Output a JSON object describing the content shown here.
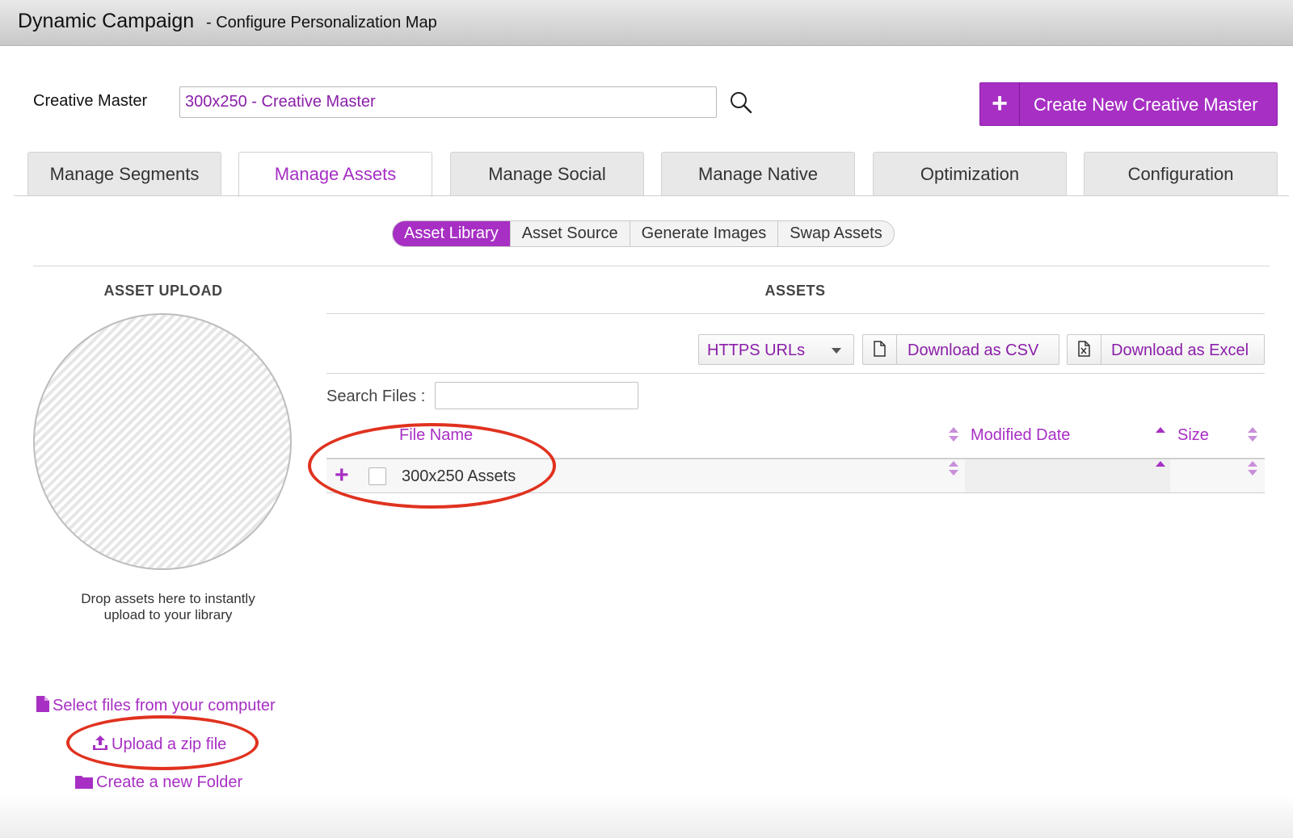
{
  "header": {
    "title": "Dynamic Campaign",
    "subtitle": "- Configure Personalization Map"
  },
  "creative_master": {
    "label": "Creative Master",
    "value": "300x250 - Creative Master",
    "search_icon": "magnifier-icon",
    "create_button": {
      "icon": "plus-icon",
      "label": "Create New Creative Master"
    }
  },
  "tabs": [
    {
      "label": "Manage Segments",
      "active": false
    },
    {
      "label": "Manage Assets",
      "active": true
    },
    {
      "label": "Manage Social",
      "active": false
    },
    {
      "label": "Manage Native",
      "active": false
    },
    {
      "label": "Optimization",
      "active": false
    },
    {
      "label": "Configuration",
      "active": false
    }
  ],
  "subtabs": [
    {
      "label": "Asset Library",
      "active": true
    },
    {
      "label": "Asset Source",
      "active": false
    },
    {
      "label": "Generate Images",
      "active": false
    },
    {
      "label": "Swap Assets",
      "active": false
    }
  ],
  "upload": {
    "title": "ASSET UPLOAD",
    "drop_text_line1": "Drop assets here to instantly",
    "drop_text_line2": "upload to your library",
    "select_files": "Select files from your computer",
    "upload_zip": "Upload a zip file",
    "new_folder": "Create a new Folder"
  },
  "assets": {
    "title": "ASSETS",
    "url_select": "HTTPS URLs",
    "download_csv": "Download as CSV",
    "download_excel": "Download as Excel",
    "search_label": "Search Files :",
    "search_value": "",
    "columns": [
      "File Name",
      "Modified Date",
      "Size"
    ],
    "rows": [
      {
        "name": "300x250 Assets",
        "modified": "",
        "size": ""
      }
    ]
  },
  "colors": {
    "accent": "#a72fc4",
    "highlight_annotation": "#e0321f"
  }
}
